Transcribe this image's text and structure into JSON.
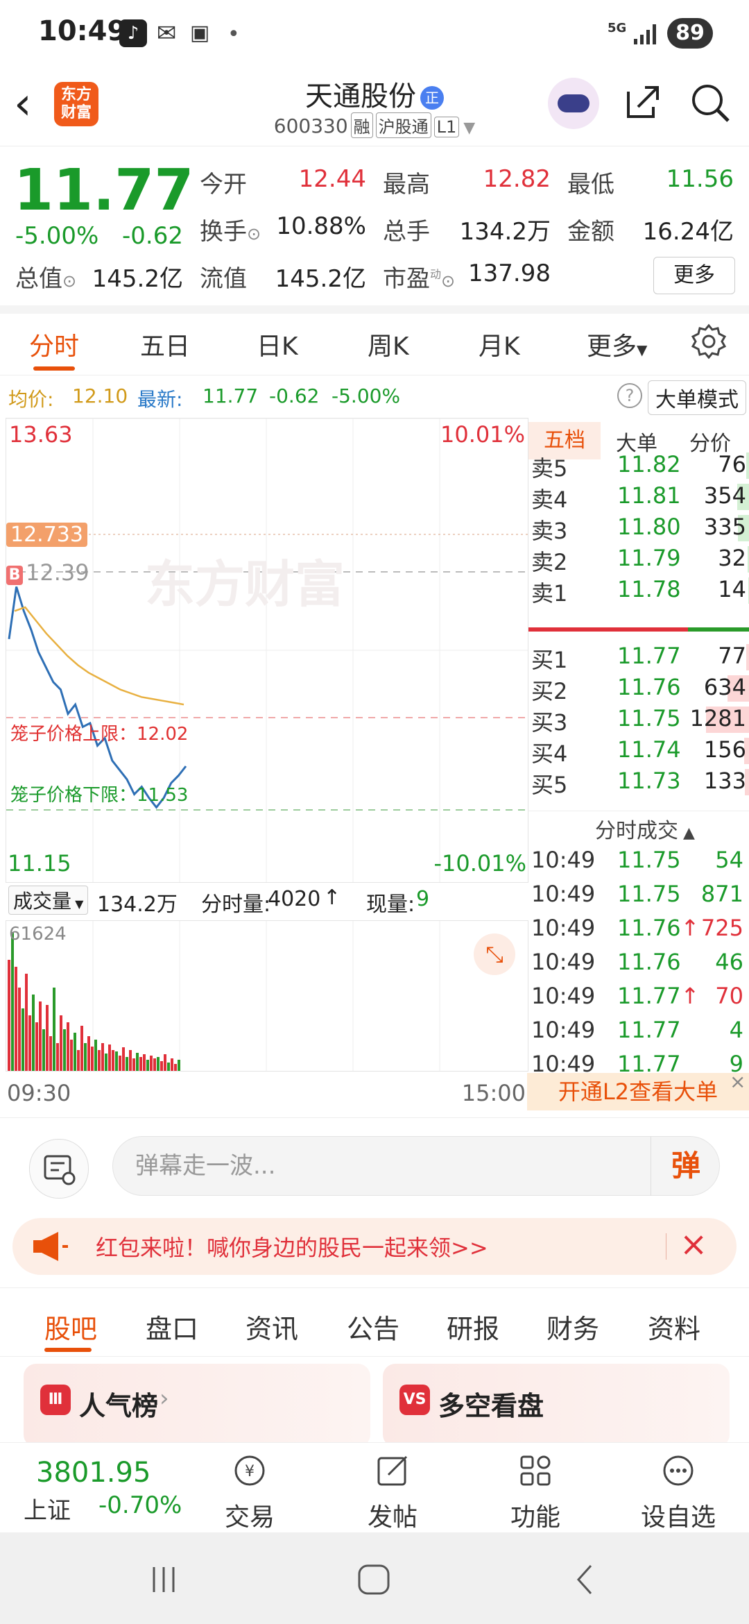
{
  "status_bar": {
    "time": "10:49",
    "network": "5G",
    "battery": "89"
  },
  "header": {
    "stock_name": "天通股份",
    "badge": "正",
    "code": "600330",
    "tags": [
      "融",
      "沪股通",
      "L1"
    ],
    "logo_text_1": "东方",
    "logo_text_2": "财富"
  },
  "quote": {
    "price": "11.77",
    "change_pct": "-5.00%",
    "change": "-0.62",
    "open_label": "今开",
    "open": "12.44",
    "high_label": "最高",
    "high": "12.82",
    "low_label": "最低",
    "low": "11.56",
    "turnover_label": "换手",
    "turnover": "10.88%",
    "volume_label": "总手",
    "volume": "134.2万",
    "amount_label": "金额",
    "amount": "16.24亿",
    "mktcap_label": "总值",
    "mktcap": "145.2亿",
    "float_label": "流值",
    "float": "145.2亿",
    "pe_label": "市盈",
    "pe_super": "动",
    "pe": "137.98",
    "more": "更多"
  },
  "chart_tabs": [
    "分时",
    "五日",
    "日K",
    "周K",
    "月K",
    "更多"
  ],
  "avg_line": {
    "avg_label": "均价:",
    "avg": "12.10",
    "last_label": "最新:",
    "last": "11.77",
    "chg": "-0.62",
    "pct": "-5.00%",
    "mode": "大单模式"
  },
  "chart": {
    "top_price": "13.63",
    "top_pct": "10.01%",
    "bottom_price": "11.15",
    "bottom_pct": "-10.01%",
    "high_marker": "12.733",
    "ref_price": "12.39",
    "b_marker": "B",
    "upper_limit": "笼子价格上限：12.02",
    "lower_limit": "笼子价格下限：11.53",
    "watermark": "东方财富"
  },
  "chart_data": {
    "type": "line",
    "x_range": [
      "09:30",
      "15:00"
    ],
    "ylim": [
      11.15,
      13.63
    ],
    "series": [
      {
        "values": [
          12.45,
          12.73,
          12.6,
          12.5,
          12.38,
          12.3,
          12.22,
          12.18,
          12.05,
          12.1,
          11.98,
          12.0,
          11.88,
          11.92,
          11.8,
          11.75,
          11.7,
          11.62,
          11.66,
          11.6,
          11.55,
          11.6,
          11.68,
          11.72,
          11.77
        ]
      },
      {
        "values": [
          12.6,
          12.62,
          12.55,
          12.48,
          12.42,
          12.36,
          12.31,
          12.27,
          12.24,
          12.21,
          12.18,
          12.16,
          12.14,
          12.13,
          12.12,
          12.11,
          12.1
        ]
      }
    ]
  },
  "orderbook": {
    "tabs": [
      "五档",
      "大单",
      "分价"
    ],
    "sells": [
      {
        "label": "卖5",
        "price": "11.82",
        "vol": "76",
        "w": 0.06
      },
      {
        "label": "卖4",
        "price": "11.81",
        "vol": "354",
        "w": 0.28
      },
      {
        "label": "卖3",
        "price": "11.80",
        "vol": "335",
        "w": 0.26
      },
      {
        "label": "卖2",
        "price": "11.79",
        "vol": "32",
        "w": 0.03
      },
      {
        "label": "卖1",
        "price": "11.78",
        "vol": "14",
        "w": 0.01
      }
    ],
    "buys": [
      {
        "label": "买1",
        "price": "11.77",
        "vol": "77",
        "w": 0.06
      },
      {
        "label": "买2",
        "price": "11.76",
        "vol": "634",
        "w": 0.5
      },
      {
        "label": "买3",
        "price": "11.75",
        "vol": "1281",
        "w": 1.0
      },
      {
        "label": "买4",
        "price": "11.74",
        "vol": "156",
        "w": 0.12
      },
      {
        "label": "买5",
        "price": "11.73",
        "vol": "133",
        "w": 0.1
      }
    ],
    "ticks_title": "分时成交",
    "ticks": [
      {
        "time": "10:49",
        "price": "11.75",
        "vol": "54",
        "up": false,
        "color": "green"
      },
      {
        "time": "10:49",
        "price": "11.75",
        "vol": "871",
        "up": false,
        "color": "green"
      },
      {
        "time": "10:49",
        "price": "11.76",
        "vol": "725",
        "up": true,
        "color": "red"
      },
      {
        "time": "10:49",
        "price": "11.76",
        "vol": "46",
        "up": false,
        "color": "green"
      },
      {
        "time": "10:49",
        "price": "11.77",
        "vol": "70",
        "up": true,
        "color": "red"
      },
      {
        "time": "10:49",
        "price": "11.77",
        "vol": "4",
        "up": false,
        "color": "green"
      },
      {
        "time": "10:49",
        "price": "11.77",
        "vol": "9",
        "up": false,
        "color": "green"
      }
    ],
    "l2_text": "开通L2查看大单"
  },
  "volume": {
    "selector": "成交量",
    "total": "134.2万",
    "minute_label": "分时量:",
    "minute": "4020",
    "now_label": "现量:",
    "now": "9",
    "max": "61624",
    "time_start": "09:30",
    "time_end": "15:00"
  },
  "danmaku": {
    "placeholder": "弹幕走一波...",
    "send": "弹"
  },
  "banner": {
    "text": "红包来啦！喊你身边的股民一起来领>>"
  },
  "bottom_tabs": [
    "股吧",
    "盘口",
    "资讯",
    "公告",
    "研报",
    "财务",
    "资料"
  ],
  "cards": {
    "left": "人气榜",
    "right": "多空看盘",
    "left_icon": "Ⅲ",
    "right_icon": "VS"
  },
  "footer": {
    "index_value": "3801.95",
    "index_name": "上证",
    "index_change": "-0.70%",
    "items": [
      "交易",
      "发帖",
      "功能",
      "设自选"
    ]
  },
  "colors": {
    "up": "#e0303a",
    "down": "#1a9a2a",
    "accent": "#e8500a"
  }
}
